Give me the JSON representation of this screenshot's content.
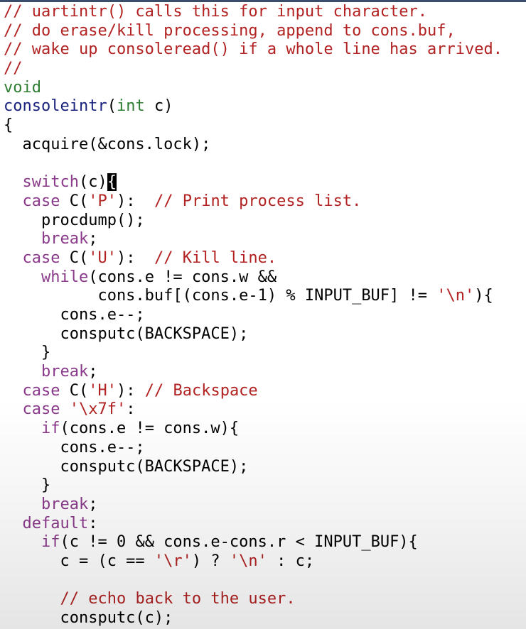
{
  "colors": {
    "comment": "#b22222",
    "keyword": "#8b3a8b",
    "type": "#2e7d32",
    "function": "#1a237e",
    "string": "#b22222",
    "plain": "#000000"
  },
  "editor": {
    "lines": [
      [
        {
          "t": "// uartintr() calls this for input character.",
          "c": "comment"
        }
      ],
      [
        {
          "t": "// do erase/kill processing, append to cons.buf,",
          "c": "comment"
        }
      ],
      [
        {
          "t": "// wake up consoleread() if a whole line has arrived.",
          "c": "comment"
        }
      ],
      [
        {
          "t": "//",
          "c": "comment"
        }
      ],
      [
        {
          "t": "void",
          "c": "type"
        }
      ],
      [
        {
          "t": "consoleintr",
          "c": "fn"
        },
        {
          "t": "(",
          "c": "plain"
        },
        {
          "t": "int",
          "c": "type"
        },
        {
          "t": " c)",
          "c": "plain"
        }
      ],
      [
        {
          "t": "{",
          "c": "plain"
        }
      ],
      [
        {
          "t": "  acquire(&cons.lock);",
          "c": "plain"
        }
      ],
      [
        {
          "t": "",
          "c": "plain"
        }
      ],
      [
        {
          "t": "  ",
          "c": "plain"
        },
        {
          "t": "switch",
          "c": "kw"
        },
        {
          "t": "(c)",
          "c": "plain"
        },
        {
          "t": "{",
          "c": "cursor"
        }
      ],
      [
        {
          "t": "  ",
          "c": "plain"
        },
        {
          "t": "case",
          "c": "kw"
        },
        {
          "t": " C(",
          "c": "plain"
        },
        {
          "t": "'P'",
          "c": "str"
        },
        {
          "t": "):  ",
          "c": "plain"
        },
        {
          "t": "// Print process list.",
          "c": "comment"
        }
      ],
      [
        {
          "t": "    procdump();",
          "c": "plain"
        }
      ],
      [
        {
          "t": "    ",
          "c": "plain"
        },
        {
          "t": "break",
          "c": "kw"
        },
        {
          "t": ";",
          "c": "plain"
        }
      ],
      [
        {
          "t": "  ",
          "c": "plain"
        },
        {
          "t": "case",
          "c": "kw"
        },
        {
          "t": " C(",
          "c": "plain"
        },
        {
          "t": "'U'",
          "c": "str"
        },
        {
          "t": "):  ",
          "c": "plain"
        },
        {
          "t": "// Kill line.",
          "c": "comment"
        }
      ],
      [
        {
          "t": "    ",
          "c": "plain"
        },
        {
          "t": "while",
          "c": "kw"
        },
        {
          "t": "(cons.e != cons.w &&",
          "c": "plain"
        }
      ],
      [
        {
          "t": "          cons.buf[(cons.e-1) % INPUT_BUF] != ",
          "c": "plain"
        },
        {
          "t": "'\\n'",
          "c": "str"
        },
        {
          "t": "){",
          "c": "plain"
        }
      ],
      [
        {
          "t": "      cons.e--;",
          "c": "plain"
        }
      ],
      [
        {
          "t": "      consputc(BACKSPACE);",
          "c": "plain"
        }
      ],
      [
        {
          "t": "    }",
          "c": "plain"
        }
      ],
      [
        {
          "t": "    ",
          "c": "plain"
        },
        {
          "t": "break",
          "c": "kw"
        },
        {
          "t": ";",
          "c": "plain"
        }
      ],
      [
        {
          "t": "  ",
          "c": "plain"
        },
        {
          "t": "case",
          "c": "kw"
        },
        {
          "t": " C(",
          "c": "plain"
        },
        {
          "t": "'H'",
          "c": "str"
        },
        {
          "t": "): ",
          "c": "plain"
        },
        {
          "t": "// Backspace",
          "c": "comment"
        }
      ],
      [
        {
          "t": "  ",
          "c": "plain"
        },
        {
          "t": "case",
          "c": "kw"
        },
        {
          "t": " ",
          "c": "plain"
        },
        {
          "t": "'\\x7f'",
          "c": "str"
        },
        {
          "t": ":",
          "c": "plain"
        }
      ],
      [
        {
          "t": "    ",
          "c": "plain"
        },
        {
          "t": "if",
          "c": "kw"
        },
        {
          "t": "(cons.e != cons.w){",
          "c": "plain"
        }
      ],
      [
        {
          "t": "      cons.e--;",
          "c": "plain"
        }
      ],
      [
        {
          "t": "      consputc(BACKSPACE);",
          "c": "plain"
        }
      ],
      [
        {
          "t": "    }",
          "c": "plain"
        }
      ],
      [
        {
          "t": "    ",
          "c": "plain"
        },
        {
          "t": "break",
          "c": "kw"
        },
        {
          "t": ";",
          "c": "plain"
        }
      ],
      [
        {
          "t": "  ",
          "c": "plain"
        },
        {
          "t": "default",
          "c": "kw"
        },
        {
          "t": ":",
          "c": "plain"
        }
      ],
      [
        {
          "t": "    ",
          "c": "plain"
        },
        {
          "t": "if",
          "c": "kw"
        },
        {
          "t": "(c != 0 && cons.e-cons.r < INPUT_BUF){",
          "c": "plain"
        }
      ],
      [
        {
          "t": "      c = (c == ",
          "c": "plain"
        },
        {
          "t": "'\\r'",
          "c": "str"
        },
        {
          "t": ") ? ",
          "c": "plain"
        },
        {
          "t": "'\\n'",
          "c": "str"
        },
        {
          "t": " : c;",
          "c": "plain"
        }
      ],
      [
        {
          "t": "",
          "c": "plain"
        }
      ],
      [
        {
          "t": "      ",
          "c": "plain"
        },
        {
          "t": "// echo back to the user.",
          "c": "comment"
        }
      ],
      [
        {
          "t": "      consputc(c);",
          "c": "plain"
        }
      ]
    ]
  }
}
